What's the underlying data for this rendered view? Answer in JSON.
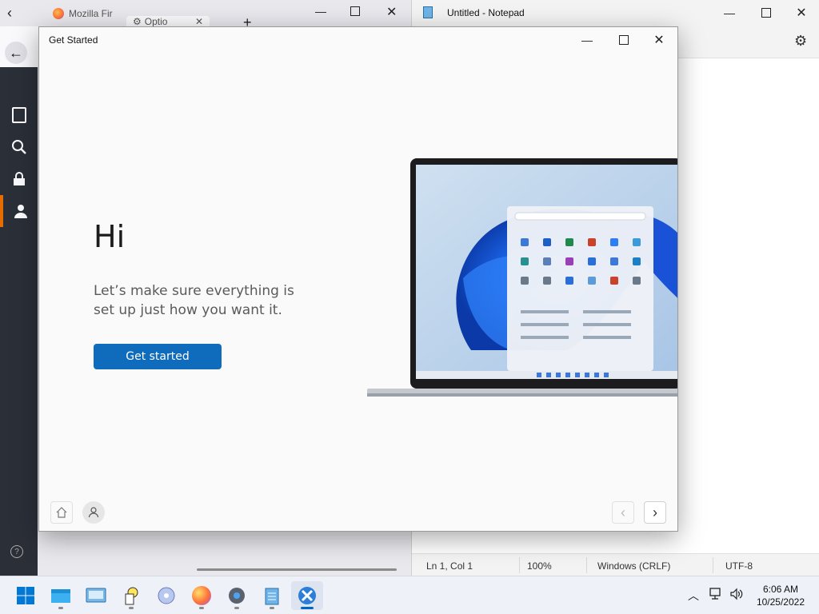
{
  "firefox": {
    "tabs": [
      {
        "label": "Mozilla Fir"
      },
      {
        "label": "Optio"
      }
    ],
    "sidebar_items": [
      "general-icon",
      "search-icon",
      "lock-icon",
      "account-icon"
    ],
    "help_glyph": "?"
  },
  "notepad": {
    "title": "Untitled - Notepad",
    "status": {
      "position": "Ln 1, Col 1",
      "zoom": "100%",
      "line_ending": "Windows (CRLF)",
      "encoding": "UTF-8"
    }
  },
  "get_started": {
    "window_title": "Get Started",
    "heading": "Hi",
    "subtitle": "Let’s make sure everything is set up just how you want it.",
    "button_label": "Get started"
  },
  "taskbar": {
    "apps": [
      "start",
      "file-explorer",
      "control-panel",
      "tips",
      "media-player",
      "firefox",
      "settings",
      "notepad",
      "get-started"
    ],
    "time": "6:06 AM",
    "date": "10/25/2022"
  },
  "colors": {
    "accent": "#0f6cbd",
    "firefox_sidebar": "#2b2f38",
    "active_indicator": "#e66c00"
  }
}
